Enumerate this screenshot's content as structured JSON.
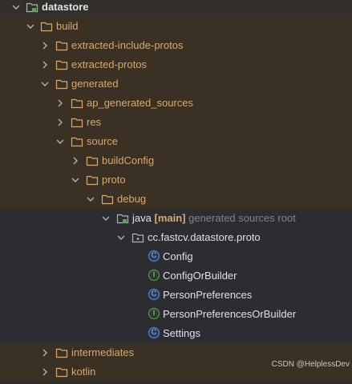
{
  "tree": {
    "datastore": "datastore",
    "build": "build",
    "extracted_include_protos": "extracted-include-protos",
    "extracted_protos": "extracted-protos",
    "generated": "generated",
    "ap_generated_sources": "ap_generated_sources",
    "res": "res",
    "source": "source",
    "buildConfig": "buildConfig",
    "proto": "proto",
    "debug": "debug",
    "java": "java",
    "java_tag": "[main]",
    "java_hint": "generated sources root",
    "package": "cc.fastcv.datastore.proto",
    "config": "Config",
    "configOrBuilder": "ConfigOrBuilder",
    "personPreferences": "PersonPreferences",
    "personPreferencesOrBuilder": "PersonPreferencesOrBuilder",
    "settings": "Settings",
    "intermediates": "intermediates",
    "kotlin": "kotlin"
  },
  "watermark": "CSDN @HelplessDev",
  "colors": {
    "background": "#2b2d30",
    "excluded_row": "#3a3124",
    "excluded_text": "#d6a971",
    "class_icon": "#5c8de2",
    "interface_icon": "#5fa65c"
  }
}
